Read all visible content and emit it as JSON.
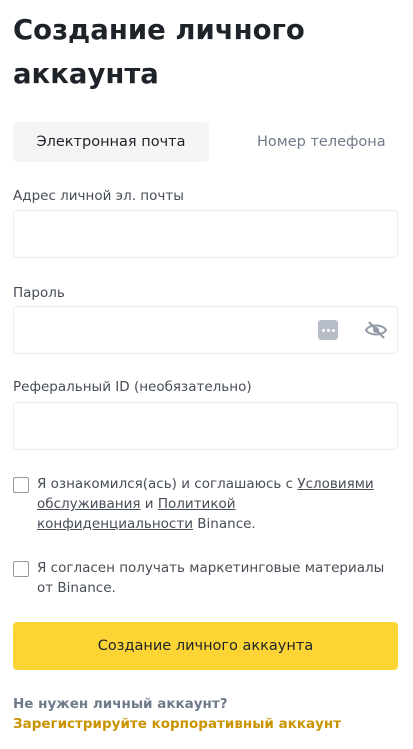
{
  "page": {
    "title": "Создание личного аккаунта"
  },
  "tabs": [
    {
      "label": "Электронная почта",
      "active": true
    },
    {
      "label": "Номер телефона",
      "active": false
    }
  ],
  "email": {
    "label": "Адрес личной эл. почты",
    "value": ""
  },
  "password": {
    "label": "Пароль",
    "value": ""
  },
  "referral": {
    "label": "Реферальный ID (необязательно)",
    "value": ""
  },
  "terms": {
    "prefix": "Я ознакомился(ась) и соглашаюсь с ",
    "terms_link": "Условиями обслуживания",
    "middle": " и ",
    "privacy_link": "Политикой конфиденциальности",
    "suffix": " Binance.",
    "checked": false
  },
  "marketing": {
    "text": "Я согласен получать маркетинговые материалы от Binance.",
    "checked": false
  },
  "submit": {
    "label": "Создание личного аккаунта"
  },
  "footer": {
    "question": "Не нужен личный аккаунт? ",
    "link": "Зарегистрируйте корпоративный аккаунт"
  },
  "colors": {
    "accent": "#fcd535",
    "link_gold": "#c99400",
    "text": "#1e2329",
    "muted": "#707a8a"
  },
  "icons": [
    "password-manager-icon",
    "eye-hidden-icon",
    "checkbox-icon"
  ]
}
